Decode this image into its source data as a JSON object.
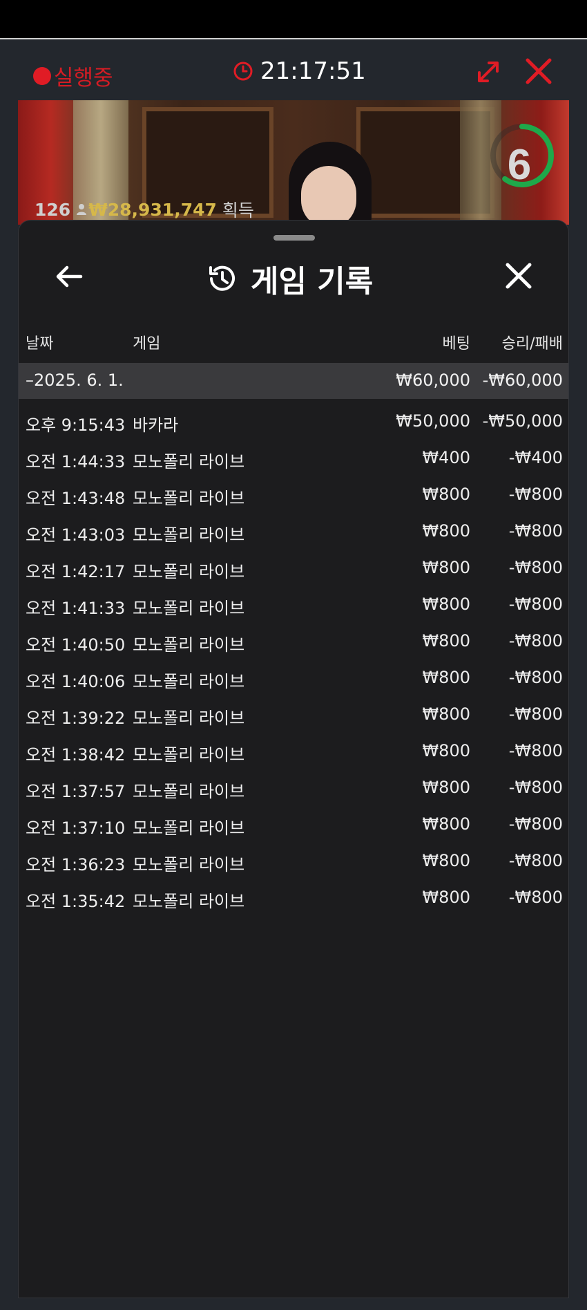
{
  "top": {
    "running_label": "실행중",
    "time": "21:17:51",
    "colors": {
      "accent_red": "#e01c25",
      "gold": "#d6b84a"
    }
  },
  "video": {
    "countdown": "6",
    "countdown_fraction": 0.6,
    "player_count": "126",
    "win_amount": "₩28,931,747",
    "win_suffix": "획득"
  },
  "sheet": {
    "title": "게임 기록",
    "columns": {
      "date": "날짜",
      "game": "게임",
      "bet": "베팅",
      "result": "승리/패배"
    },
    "day": {
      "date": "–2025. 6. 1.",
      "bet": "₩60,000",
      "result": "-₩60,000"
    },
    "rows": [
      {
        "time": "오후 9:15:43",
        "game": "바카라",
        "bet": "₩50,000",
        "result": "-₩50,000"
      },
      {
        "time": "오전 1:44:33",
        "game": "모노폴리 라이브",
        "bet": "₩400",
        "result": "-₩400"
      },
      {
        "time": "오전 1:43:48",
        "game": "모노폴리 라이브",
        "bet": "₩800",
        "result": "-₩800"
      },
      {
        "time": "오전 1:43:03",
        "game": "모노폴리 라이브",
        "bet": "₩800",
        "result": "-₩800"
      },
      {
        "time": "오전 1:42:17",
        "game": "모노폴리 라이브",
        "bet": "₩800",
        "result": "-₩800"
      },
      {
        "time": "오전 1:41:33",
        "game": "모노폴리 라이브",
        "bet": "₩800",
        "result": "-₩800"
      },
      {
        "time": "오전 1:40:50",
        "game": "모노폴리 라이브",
        "bet": "₩800",
        "result": "-₩800"
      },
      {
        "time": "오전 1:40:06",
        "game": "모노폴리 라이브",
        "bet": "₩800",
        "result": "-₩800"
      },
      {
        "time": "오전 1:39:22",
        "game": "모노폴리 라이브",
        "bet": "₩800",
        "result": "-₩800"
      },
      {
        "time": "오전 1:38:42",
        "game": "모노폴리 라이브",
        "bet": "₩800",
        "result": "-₩800"
      },
      {
        "time": "오전 1:37:57",
        "game": "모노폴리 라이브",
        "bet": "₩800",
        "result": "-₩800"
      },
      {
        "time": "오전 1:37:10",
        "game": "모노폴리 라이브",
        "bet": "₩800",
        "result": "-₩800"
      },
      {
        "time": "오전 1:36:23",
        "game": "모노폴리 라이브",
        "bet": "₩800",
        "result": "-₩800"
      },
      {
        "time": "오전 1:35:42",
        "game": "모노폴리 라이브",
        "bet": "₩800",
        "result": "-₩800"
      }
    ]
  }
}
